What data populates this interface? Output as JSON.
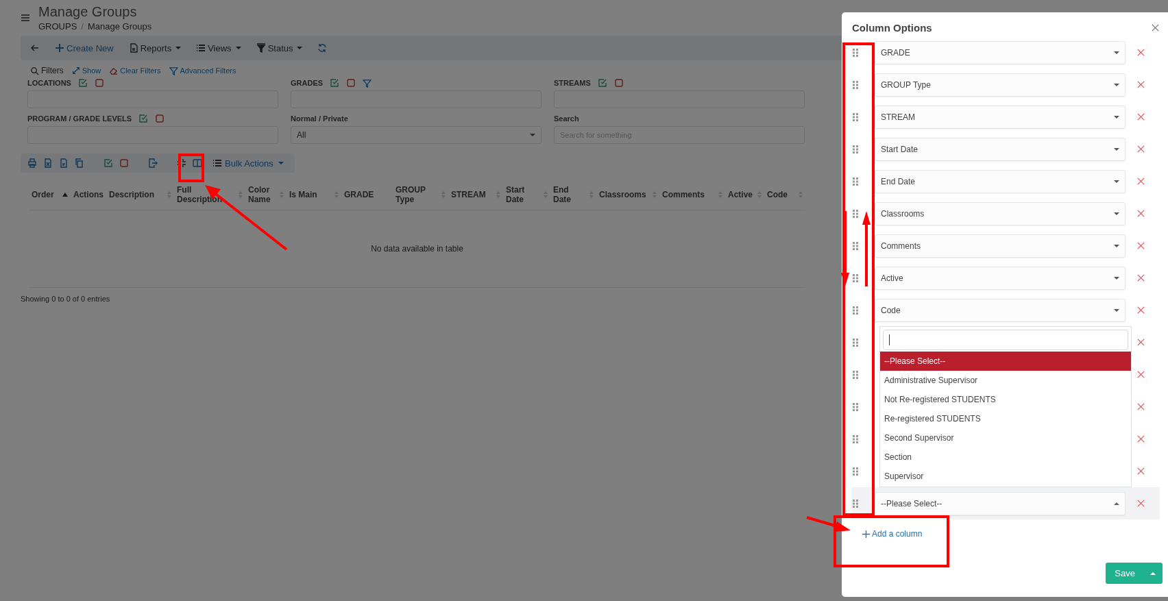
{
  "header": {
    "title": "Manage Groups",
    "breadcrumb": [
      "GROUPS",
      "Manage Groups"
    ],
    "separator": "/"
  },
  "toolbar": [
    {
      "kind": "back"
    },
    {
      "kind": "create",
      "label": "Create New"
    },
    {
      "kind": "reports",
      "label": "Reports"
    },
    {
      "kind": "views",
      "label": "Views"
    },
    {
      "kind": "status",
      "label": "Status"
    },
    {
      "kind": "refresh"
    }
  ],
  "filter_links": [
    {
      "kind": "search",
      "label": "Filters"
    },
    {
      "kind": "show",
      "label": "Show"
    },
    {
      "kind": "clear",
      "label": "Clear Filters"
    },
    {
      "kind": "advanced",
      "label": "Advanced Filters"
    }
  ],
  "filters": [
    {
      "kind": "multi",
      "label": "LOCATIONS",
      "funnel": false
    },
    {
      "kind": "multi",
      "label": "GRADES",
      "funnel": true
    },
    {
      "kind": "multi",
      "label": "STREAMS",
      "funnel": false
    },
    {
      "kind": "multi",
      "label": "PROGRAM / GRADE LEVELS",
      "funnel": false
    },
    {
      "kind": "select",
      "label": "Normal / Private",
      "value": "All"
    },
    {
      "kind": "text",
      "label": "Search",
      "placeholder": "Search for something"
    }
  ],
  "table_tools": {
    "buttons": [
      {
        "kind": "print"
      },
      {
        "kind": "excel"
      },
      {
        "kind": "pdf"
      },
      {
        "kind": "copy"
      },
      {
        "kind": "check"
      },
      {
        "kind": "uncheck"
      },
      {
        "kind": "export"
      },
      {
        "kind": "compress"
      },
      {
        "kind": "columns"
      }
    ],
    "bulk": "Bulk Actions"
  },
  "table": {
    "columns": [
      {
        "label": "Order",
        "sortable": true,
        "sorted": true
      },
      {
        "label": "Actions",
        "sortable": false,
        "sorted": false
      },
      {
        "label": "Description",
        "sortable": true,
        "sorted": false
      },
      {
        "label": "Full Description",
        "sortable": true,
        "sorted": false
      },
      {
        "label": "Color Name",
        "sortable": true,
        "sorted": false
      },
      {
        "label": "Is Main",
        "sortable": true,
        "sorted": false
      },
      {
        "label": "GRADE",
        "sortable": false,
        "sorted": false
      },
      {
        "label": "GROUP Type",
        "sortable": true,
        "sorted": false
      },
      {
        "label": "STREAM",
        "sortable": true,
        "sorted": false
      },
      {
        "label": "Start Date",
        "sortable": true,
        "sorted": false
      },
      {
        "label": "End Date",
        "sortable": true,
        "sorted": false
      },
      {
        "label": "Classrooms",
        "sortable": true,
        "sorted": false
      },
      {
        "label": "Comments",
        "sortable": true,
        "sorted": false
      },
      {
        "label": "Active",
        "sortable": true,
        "sorted": false
      },
      {
        "label": "Code",
        "sortable": true,
        "sorted": false
      }
    ],
    "empty": "No data available in table",
    "info": "Showing 0 to 0 of 0 entries"
  },
  "modal": {
    "title": "Column Options",
    "rows": [
      {
        "kind": "select",
        "value": "GRADE"
      },
      {
        "kind": "select",
        "value": "GROUP Type"
      },
      {
        "kind": "select",
        "value": "STREAM"
      },
      {
        "kind": "select",
        "value": "Start Date"
      },
      {
        "kind": "select",
        "value": "End Date"
      },
      {
        "kind": "select",
        "value": "Classrooms"
      },
      {
        "kind": "select",
        "value": "Comments"
      },
      {
        "kind": "select",
        "value": "Active"
      },
      {
        "kind": "select",
        "value": "Code"
      },
      {
        "kind": "covered"
      },
      {
        "kind": "covered"
      },
      {
        "kind": "covered"
      },
      {
        "kind": "covered"
      },
      {
        "kind": "covered"
      },
      {
        "kind": "open",
        "value": "--Please Select--"
      }
    ],
    "dropdown": {
      "options": [
        {
          "label": "--Please Select--",
          "selected": true
        },
        {
          "label": "Administrative Supervisor",
          "selected": false
        },
        {
          "label": "Not Re-registered STUDENTS",
          "selected": false
        },
        {
          "label": "Re-registered STUDENTS",
          "selected": false
        },
        {
          "label": "Second Supervisor",
          "selected": false
        },
        {
          "label": "Section",
          "selected": false
        },
        {
          "label": "Supervisor",
          "selected": false
        }
      ]
    },
    "add_column": "Add a column",
    "save": "Save"
  }
}
